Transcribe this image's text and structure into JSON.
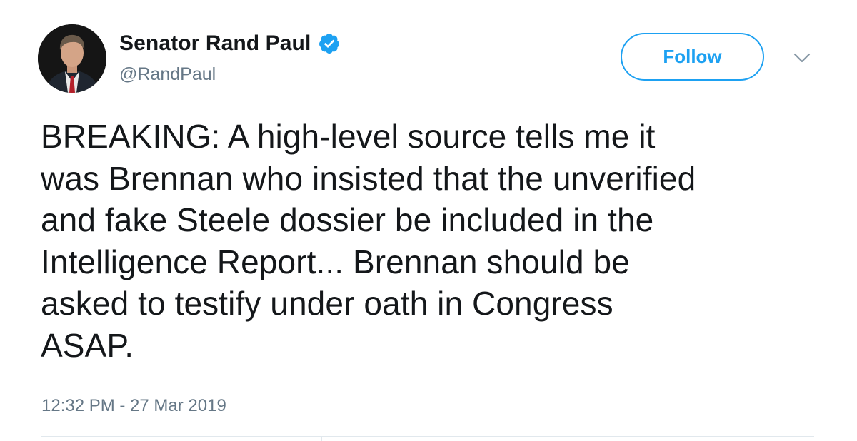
{
  "author": {
    "display_name": "Senator Rand Paul",
    "handle": "@RandPaul",
    "verified": true
  },
  "actions": {
    "follow_label": "Follow"
  },
  "tweet": {
    "lines": [
      "BREAKING: A high-level source tells me it",
      "was Brennan who insisted that the unverified",
      "and fake Steele dossier be included in the",
      "Intelligence Report... Brennan should be",
      "asked to testify under oath in Congress",
      "ASAP."
    ],
    "timestamp": "12:32 PM - 27 Mar 2019"
  },
  "icons": {
    "verified": "verified-badge-icon",
    "more": "chevron-down-icon"
  },
  "colors": {
    "brand_blue": "#1da1f2",
    "text_primary": "#14171a",
    "text_secondary": "#657786",
    "divider": "#e1e8ed"
  }
}
